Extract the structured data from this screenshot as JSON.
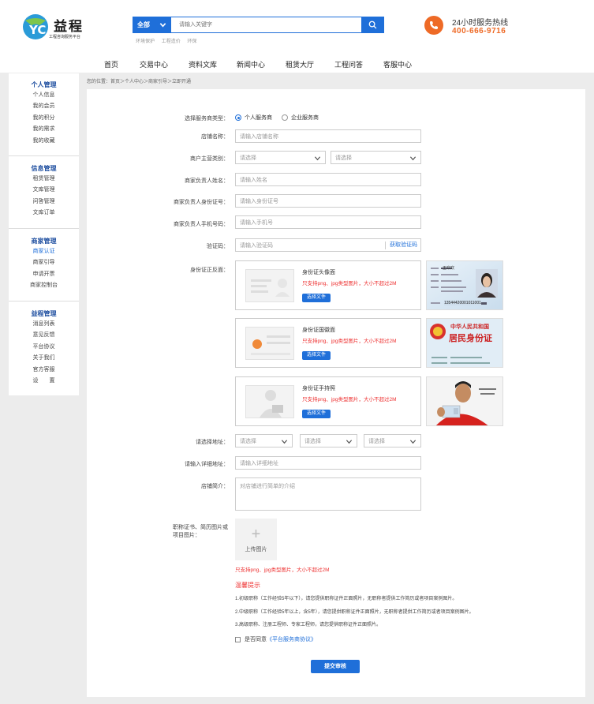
{
  "brand": {
    "name": "益程",
    "tagline": "工程咨询服务平台"
  },
  "search": {
    "category": "全部",
    "placeholder": "请输入关键字",
    "hot_words": [
      "环境保护",
      "工程造价",
      "环保"
    ]
  },
  "hotline": {
    "title": "24小时服务热线",
    "number": "400-666-9716"
  },
  "nav": [
    "首页",
    "交易中心",
    "资料文库",
    "新闻中心",
    "租赁大厅",
    "工程问答",
    "客服中心"
  ],
  "sidebar": [
    {
      "title": "个人管理",
      "items": [
        "个人信息",
        "我的会员",
        "我的积分",
        "我的需求",
        "我的收藏"
      ]
    },
    {
      "title": "信息管理",
      "items": [
        "租赁管理",
        "文库管理",
        "问答管理",
        "文库订单"
      ]
    },
    {
      "title": "商家管理",
      "items": [
        "商家认证",
        "商家引导",
        "申请开票",
        "商家控制台"
      ]
    },
    {
      "title": "益程管理",
      "items": [
        "消息列表",
        "意见反馈",
        "平台协议",
        "关于我们",
        "官方客服",
        "设　　置"
      ]
    }
  ],
  "breadcrumb": "您的位置：首页＞个人中心＞商家引导＞立即开通",
  "form": {
    "type_label": "选择服务商类型：",
    "type_personal": "个人服务商",
    "type_enterprise": "企业服务商",
    "shop_label": "店铺名称：",
    "shop_ph": "请输入店铺名称",
    "category_label": "商户主营类别：",
    "select_ph": "请选择",
    "name_label": "商家负责人姓名：",
    "name_ph": "请输入姓名",
    "id_label": "商家负责人身份证号：",
    "id_ph": "请输入身份证号",
    "phone_label": "商家负责人手机号码：",
    "phone_ph": "请输入手机号",
    "code_label": "验证码：",
    "code_ph": "请输入验证码",
    "code_btn": "获取验证码",
    "idcard_label": "身份证正反面：",
    "uploads": [
      {
        "title": "身份证头像面",
        "hint": "只支持png、jpg类型图片，大小不超过2M",
        "button": "选择文件"
      },
      {
        "title": "身份证国徽面",
        "hint": "只支持png、jpg类型图片，大小不超过2M",
        "button": "选择文件"
      },
      {
        "title": "身份证手持照",
        "hint": "只支持png、jpg类型图片，大小不超过2M",
        "button": "选择文件"
      }
    ],
    "sample_front": {
      "name": "王欢欢",
      "number": "13544420001011001"
    },
    "sample_back": {
      "line1": "中华人民共和国",
      "line2": "居民身份证"
    },
    "address_label": "请选择地址：",
    "detail_label": "请输入详细地址：",
    "detail_ph": "请输入详细地址",
    "intro_label": "店铺简介：",
    "intro_ph": "对店铺进行简单的介绍",
    "cert_label1": "职称证书、简历图片或",
    "cert_label2": "项目图片：",
    "upload_pic": "上传图片",
    "pic_hint": "只支持png、jpg类型图片，大小不超过2M",
    "tip_title": "温馨提示",
    "tips": [
      "1.初级职称（工作经验5年以下），请您提供职称证件正面照片，无职称者提供工作简历或者项目案例图片。",
      "2.中级职称（工作经验5年以上，含5年），请您提供职称证件正面照片，无职称者提供工作简历或者项目案例图片。",
      "3.高级职称、注册工程师、专家工程师，请您提供职称证件正面照片。"
    ],
    "agree_text": "是否同意",
    "agree_link": "《平台服务商协议》",
    "submit": "提交审核"
  },
  "colors": {
    "primary": "#1f6fd9",
    "accent": "#ee6a26",
    "alert": "#e33333"
  }
}
